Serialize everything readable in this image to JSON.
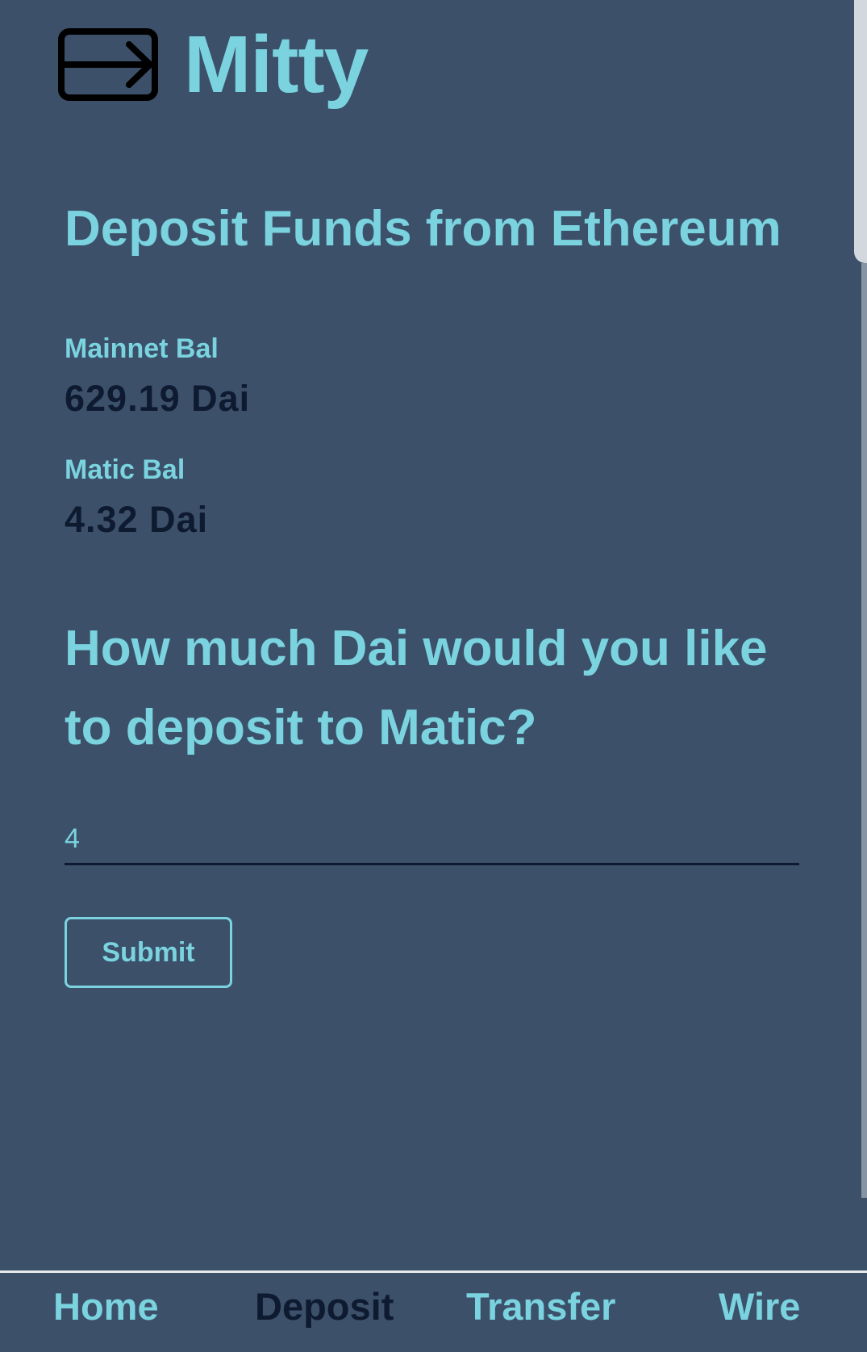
{
  "header": {
    "logo_icon": "wallet-transfer-arrow-icon",
    "title": "Mitty"
  },
  "page": {
    "title": "Deposit Funds from Ethereum"
  },
  "balances": {
    "mainnet": {
      "label": "Mainnet Bal",
      "value": "629.19 Dai"
    },
    "matic": {
      "label": "Matic Bal",
      "value": "4.32 Dai"
    }
  },
  "deposit": {
    "question": "How much Dai would you like to deposit to Matic?",
    "amount_value": "4",
    "submit_label": "Submit"
  },
  "nav": {
    "active": "Deposit",
    "items": [
      {
        "label": "Home"
      },
      {
        "label": "Deposit"
      },
      {
        "label": "Transfer"
      },
      {
        "label": "Wire"
      }
    ]
  },
  "colors": {
    "background": "#3c506a",
    "accent": "#7ad3df",
    "dark_text": "#0e1a30",
    "nav_border": "#e6e9ee"
  }
}
